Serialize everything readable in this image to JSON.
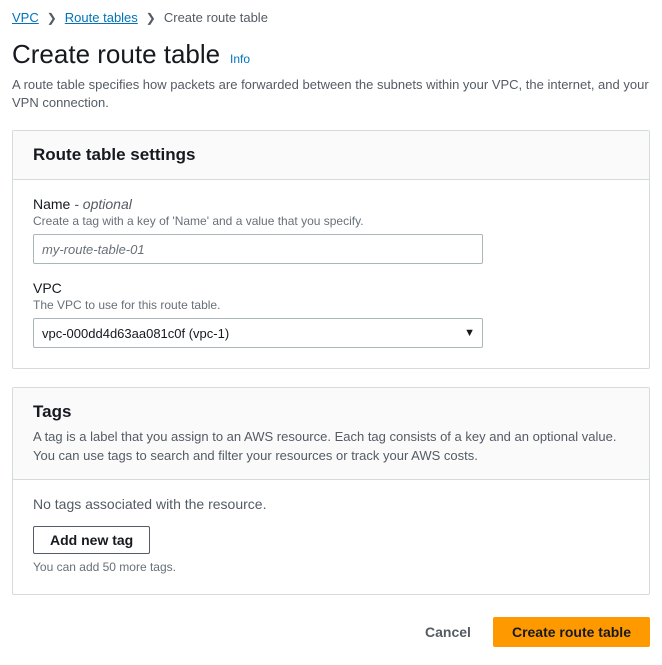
{
  "breadcrumb": {
    "vpc": "VPC",
    "route_tables": "Route tables",
    "current": "Create route table"
  },
  "page": {
    "title": "Create route table",
    "info_link": "Info",
    "subtitle": "A route table specifies how packets are forwarded between the subnets within your VPC, the internet, and your VPN connection."
  },
  "settings_panel": {
    "heading": "Route table settings",
    "name": {
      "label": "Name",
      "optional_suffix": "- optional",
      "helper": "Create a tag with a key of 'Name' and a value that you specify.",
      "placeholder": "my-route-table-01"
    },
    "vpc": {
      "label": "VPC",
      "helper": "The VPC to use for this route table.",
      "selected": "vpc-000dd4d63aa081c0f (vpc-1)"
    }
  },
  "tags_panel": {
    "heading": "Tags",
    "description": "A tag is a label that you assign to an AWS resource. Each tag consists of a key and an optional value. You can use tags to search and filter your resources or track your AWS costs.",
    "empty_text": "No tags associated with the resource.",
    "add_button": "Add new tag",
    "remaining_text": "You can add 50 more tags."
  },
  "footer": {
    "cancel": "Cancel",
    "submit": "Create route table"
  }
}
